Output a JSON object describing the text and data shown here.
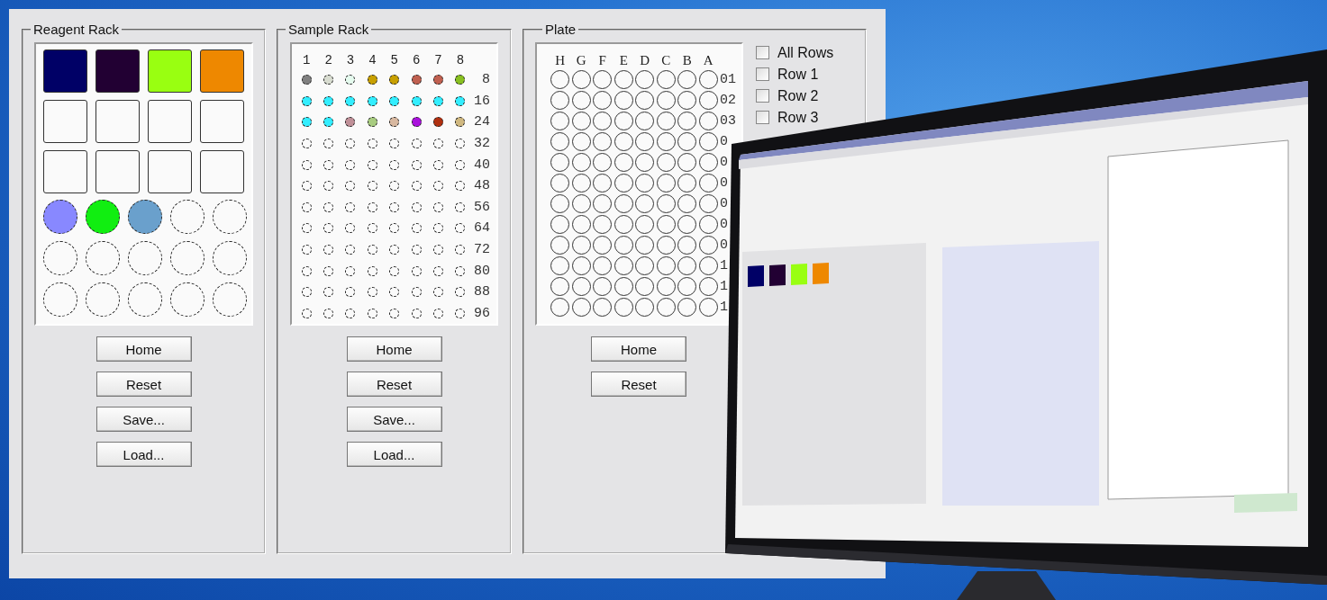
{
  "reagent_rack": {
    "title": "Reagent Rack",
    "bottles": [
      {
        "filled": true,
        "color": "#000066"
      },
      {
        "filled": true,
        "color": "#220033"
      },
      {
        "filled": true,
        "color": "#99ff11"
      },
      {
        "filled": true,
        "color": "#ee8800"
      },
      {
        "filled": false
      },
      {
        "filled": false
      },
      {
        "filled": false
      },
      {
        "filled": false
      },
      {
        "filled": false
      },
      {
        "filled": false
      },
      {
        "filled": false
      },
      {
        "filled": false
      }
    ],
    "tubes": [
      {
        "filled": true,
        "color": "#8888ff"
      },
      {
        "filled": true,
        "color": "#11ee11"
      },
      {
        "filled": true,
        "color": "#6aa0cc"
      },
      {
        "filled": false
      },
      {
        "filled": false
      },
      {
        "filled": false
      },
      {
        "filled": false
      },
      {
        "filled": false
      },
      {
        "filled": false
      },
      {
        "filled": false
      },
      {
        "filled": false
      },
      {
        "filled": false
      },
      {
        "filled": false
      },
      {
        "filled": false
      },
      {
        "filled": false
      }
    ],
    "buttons": [
      "Home",
      "Reset",
      "Save...",
      "Load..."
    ]
  },
  "sample_rack": {
    "title": "Sample Rack",
    "columns": [
      "1",
      "2",
      "3",
      "4",
      "5",
      "6",
      "7",
      "8"
    ],
    "rows": [
      {
        "label": "8",
        "wells": [
          {
            "filled": true,
            "color": "#808080"
          },
          {
            "filled": true,
            "color": "#d8dcd0"
          },
          {
            "filled": true,
            "color": "#e6fbef"
          },
          {
            "filled": true,
            "color": "#c8a000"
          },
          {
            "filled": true,
            "color": "#c8a000"
          },
          {
            "filled": true,
            "color": "#c06050"
          },
          {
            "filled": true,
            "color": "#c06050"
          },
          {
            "filled": true,
            "color": "#88c020"
          }
        ]
      },
      {
        "label": "16",
        "wells": [
          {
            "filled": true,
            "color": "#33eeff"
          },
          {
            "filled": true,
            "color": "#33eeff"
          },
          {
            "filled": true,
            "color": "#33eeff"
          },
          {
            "filled": true,
            "color": "#33eeff"
          },
          {
            "filled": true,
            "color": "#33eeff"
          },
          {
            "filled": true,
            "color": "#33eeff"
          },
          {
            "filled": true,
            "color": "#33eeff"
          },
          {
            "filled": true,
            "color": "#33eeff"
          }
        ]
      },
      {
        "label": "24",
        "wells": [
          {
            "filled": true,
            "color": "#33eeff"
          },
          {
            "filled": true,
            "color": "#33eeff"
          },
          {
            "filled": true,
            "color": "#c09098"
          },
          {
            "filled": true,
            "color": "#a8cc80"
          },
          {
            "filled": true,
            "color": "#d8b8a0"
          },
          {
            "filled": true,
            "color": "#aa11dd"
          },
          {
            "filled": true,
            "color": "#b03010"
          },
          {
            "filled": true,
            "color": "#d0b880"
          }
        ]
      },
      {
        "label": "32",
        "wells": [
          {
            "filled": false
          },
          {
            "filled": false
          },
          {
            "filled": false
          },
          {
            "filled": false
          },
          {
            "filled": false
          },
          {
            "filled": false
          },
          {
            "filled": false
          },
          {
            "filled": false
          }
        ]
      },
      {
        "label": "40",
        "wells": [
          {
            "filled": false
          },
          {
            "filled": false
          },
          {
            "filled": false
          },
          {
            "filled": false
          },
          {
            "filled": false
          },
          {
            "filled": false
          },
          {
            "filled": false
          },
          {
            "filled": false
          }
        ]
      },
      {
        "label": "48",
        "wells": [
          {
            "filled": false
          },
          {
            "filled": false
          },
          {
            "filled": false
          },
          {
            "filled": false
          },
          {
            "filled": false
          },
          {
            "filled": false
          },
          {
            "filled": false
          },
          {
            "filled": false
          }
        ]
      },
      {
        "label": "56",
        "wells": [
          {
            "filled": false
          },
          {
            "filled": false
          },
          {
            "filled": false
          },
          {
            "filled": false
          },
          {
            "filled": false
          },
          {
            "filled": false
          },
          {
            "filled": false
          },
          {
            "filled": false
          }
        ]
      },
      {
        "label": "64",
        "wells": [
          {
            "filled": false
          },
          {
            "filled": false
          },
          {
            "filled": false
          },
          {
            "filled": false
          },
          {
            "filled": false
          },
          {
            "filled": false
          },
          {
            "filled": false
          },
          {
            "filled": false
          }
        ]
      },
      {
        "label": "72",
        "wells": [
          {
            "filled": false
          },
          {
            "filled": false
          },
          {
            "filled": false
          },
          {
            "filled": false
          },
          {
            "filled": false
          },
          {
            "filled": false
          },
          {
            "filled": false
          },
          {
            "filled": false
          }
        ]
      },
      {
        "label": "80",
        "wells": [
          {
            "filled": false
          },
          {
            "filled": false
          },
          {
            "filled": false
          },
          {
            "filled": false
          },
          {
            "filled": false
          },
          {
            "filled": false
          },
          {
            "filled": false
          },
          {
            "filled": false
          }
        ]
      },
      {
        "label": "88",
        "wells": [
          {
            "filled": false
          },
          {
            "filled": false
          },
          {
            "filled": false
          },
          {
            "filled": false
          },
          {
            "filled": false
          },
          {
            "filled": false
          },
          {
            "filled": false
          },
          {
            "filled": false
          }
        ]
      },
      {
        "label": "96",
        "wells": [
          {
            "filled": false
          },
          {
            "filled": false
          },
          {
            "filled": false
          },
          {
            "filled": false
          },
          {
            "filled": false
          },
          {
            "filled": false
          },
          {
            "filled": false
          },
          {
            "filled": false
          }
        ]
      }
    ],
    "buttons": [
      "Home",
      "Reset",
      "Save...",
      "Load..."
    ]
  },
  "plate": {
    "title": "Plate",
    "columns": [
      "H",
      "G",
      "F",
      "E",
      "D",
      "C",
      "B",
      "A"
    ],
    "rows": [
      {
        "label": "01"
      },
      {
        "label": "02"
      },
      {
        "label": "03"
      },
      {
        "label": "0"
      },
      {
        "label": "0"
      },
      {
        "label": "0"
      },
      {
        "label": "0"
      },
      {
        "label": "0"
      },
      {
        "label": "0"
      },
      {
        "label": "1"
      },
      {
        "label": "1"
      },
      {
        "label": "1"
      }
    ],
    "row_checkboxes": [
      {
        "label": "All Rows",
        "checked": false
      },
      {
        "label": "Row 1",
        "checked": false
      },
      {
        "label": "Row 2",
        "checked": false
      },
      {
        "label": "Row 3",
        "checked": false
      }
    ],
    "buttons": [
      "Home",
      "Reset"
    ]
  }
}
